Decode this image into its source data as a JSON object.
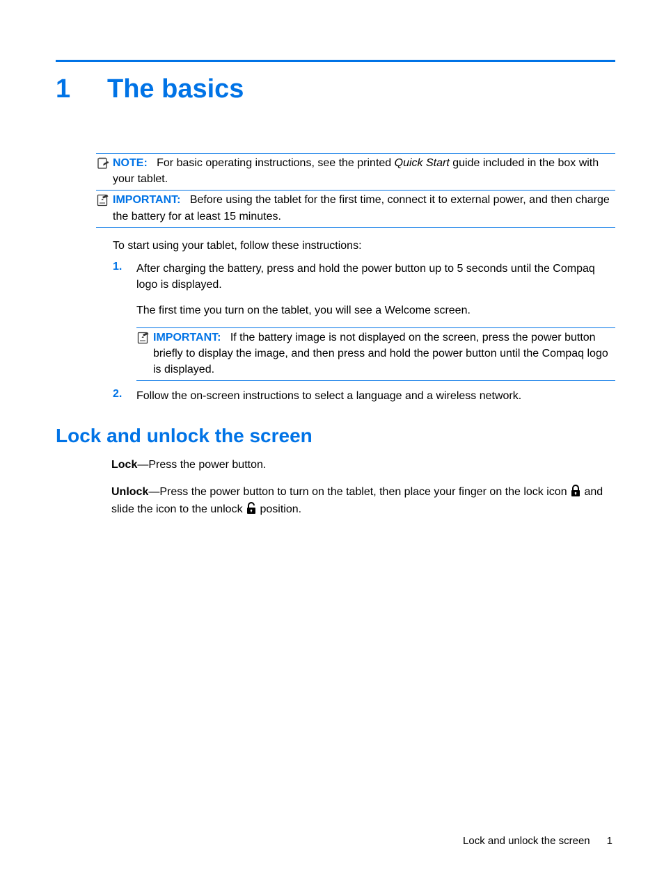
{
  "chapter": {
    "number": "1",
    "title": "The basics"
  },
  "note": {
    "label": "NOTE:",
    "pre": "For basic operating instructions, see the printed ",
    "italic": "Quick Start",
    "post": " guide included in the box with your tablet."
  },
  "important1": {
    "label": "IMPORTANT:",
    "text": "Before using the tablet for the first time, connect it to external power, and then charge the battery for at least 15 minutes."
  },
  "intro": "To start using your tablet, follow these instructions:",
  "steps": {
    "n1": "1.",
    "s1a": "After charging the battery, press and hold the power button up to 5 seconds until the Compaq logo is displayed.",
    "s1b": "The first time you turn on the tablet, you will see a Welcome screen.",
    "important2": {
      "label": "IMPORTANT:",
      "text": "If the battery image is not displayed on the screen, press the power button briefly to display the image, and then press and hold the power button until the Compaq logo is displayed."
    },
    "n2": "2.",
    "s2": "Follow the on-screen instructions to select a language and a wireless network."
  },
  "section": {
    "heading": "Lock and unlock the screen",
    "lock_label": "Lock",
    "lock_text": "—Press the power button.",
    "unlock_label": "Unlock",
    "unlock_pre": "—Press the power button to turn on the tablet, then place your finger on the lock icon ",
    "unlock_mid": " and slide the icon to the unlock ",
    "unlock_post": " position."
  },
  "footer": {
    "text": "Lock and unlock the screen",
    "page": "1"
  }
}
